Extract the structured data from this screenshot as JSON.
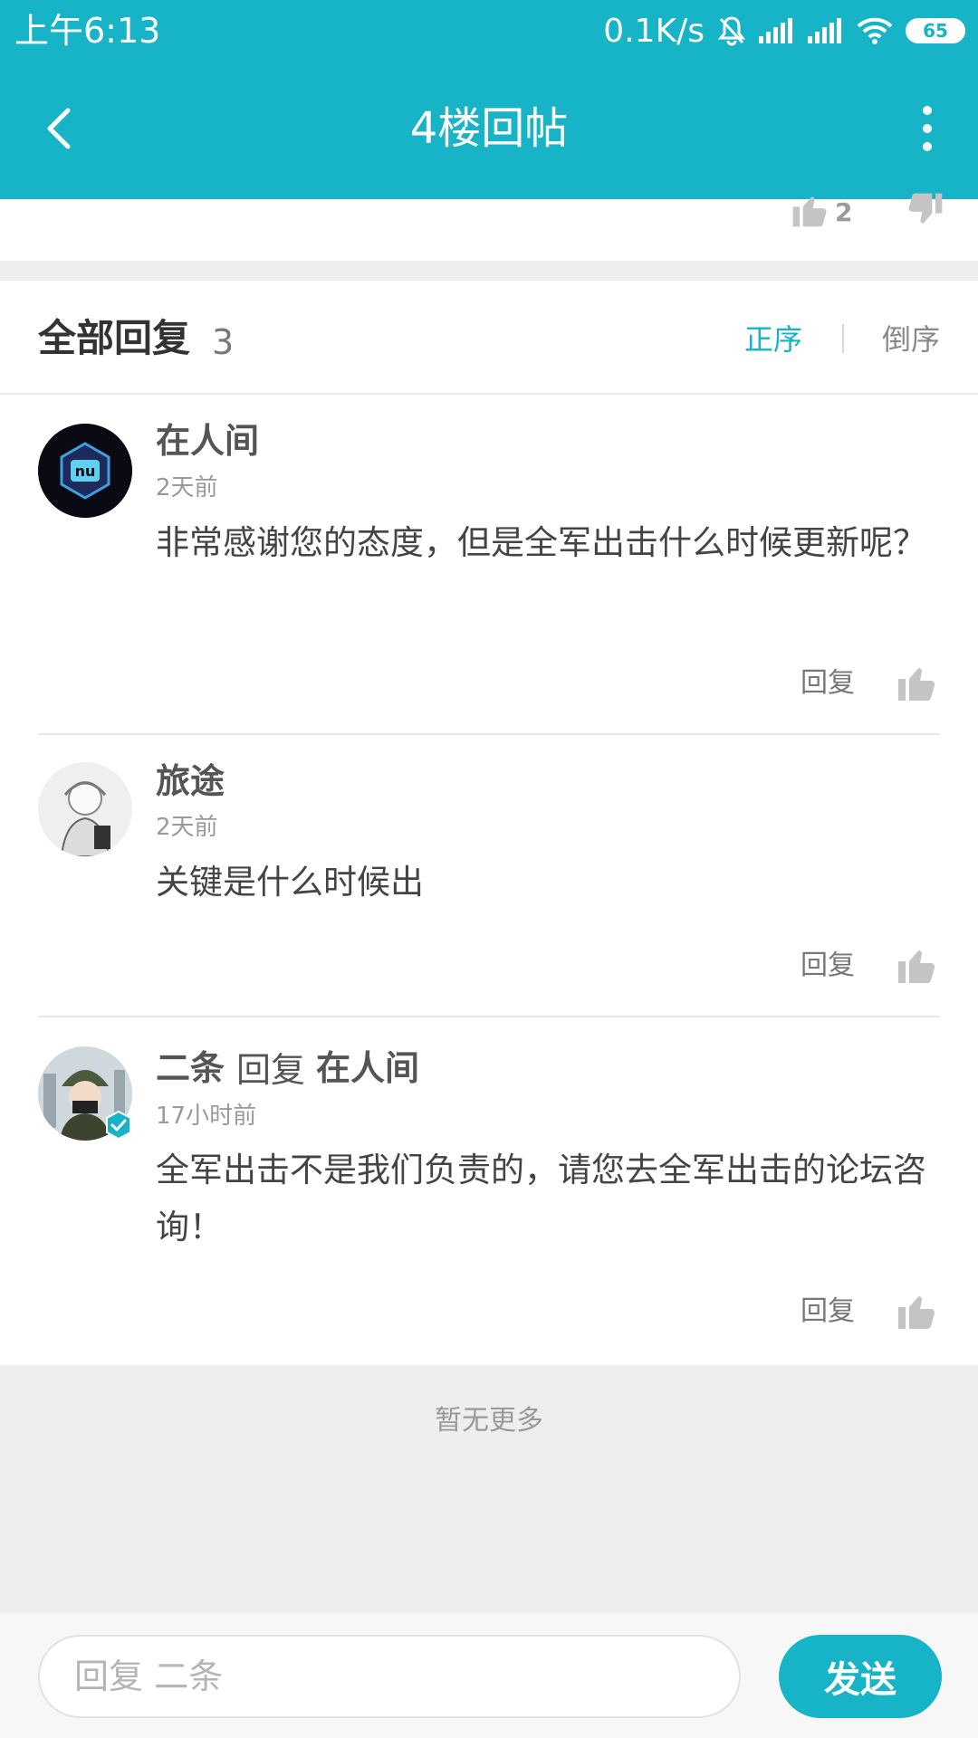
{
  "status_bar": {
    "time": "上午6:13",
    "net_speed": "0.1K/s",
    "battery": "65"
  },
  "header": {
    "title": "4楼回帖"
  },
  "post": {
    "likes": "2"
  },
  "replies_section": {
    "title": "全部回复",
    "count": "3",
    "sort_asc": "正序",
    "sort_desc": "倒序"
  },
  "replies": [
    {
      "user": "在人间",
      "time": "2天前",
      "content": "非常感谢您的态度，但是全军出击什么时候更新呢？",
      "reply_label": "回复"
    },
    {
      "user": "旅途",
      "time": "2天前",
      "content": "关键是什么时候出",
      "reply_label": "回复"
    },
    {
      "user": "二条",
      "reply_to_label": "回复",
      "reply_to_user": "在人间",
      "time": "17小时前",
      "content": "全军出击不是我们负责的，请您去全军出击的论坛咨询！",
      "reply_label": "回复"
    }
  ],
  "footer": {
    "no_more": "暂无更多"
  },
  "composer": {
    "placeholder": "回复 二条",
    "send_label": "发送"
  },
  "colors": {
    "accent": "#17b4c8",
    "background_gray": "#eeeeee"
  }
}
